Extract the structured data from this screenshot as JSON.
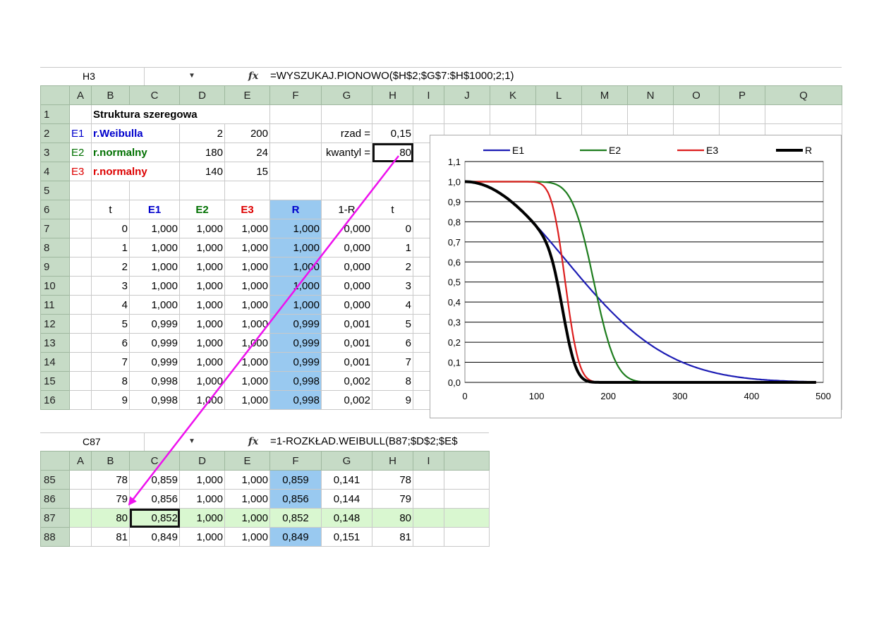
{
  "top": {
    "name_box": "H3",
    "formula": "=WYSZUKAJ.PIONOWO($H$2;$G$7:$H$1000;2;1)",
    "columns": [
      "A",
      "B",
      "C",
      "D",
      "E",
      "F",
      "G",
      "H",
      "I",
      "J",
      "K",
      "L",
      "M",
      "N",
      "O",
      "P",
      "Q"
    ],
    "row_headers": [
      "1",
      "2",
      "3",
      "4",
      "5",
      "6",
      "7",
      "8",
      "9",
      "10",
      "11",
      "12",
      "13",
      "14",
      "15",
      "16"
    ],
    "title": "Struktura szeregowa",
    "elements": [
      {
        "id": "E1",
        "dist": "r.Weibulla",
        "p1": "2",
        "p2": "200"
      },
      {
        "id": "E2",
        "dist": "r.normalny",
        "p1": "180",
        "p2": "24"
      },
      {
        "id": "E3",
        "dist": "r.normalny",
        "p1": "140",
        "p2": "15"
      }
    ],
    "rzad_label": "rzad =",
    "rzad_value": "0,15",
    "kwantyl_label": "kwantyl =",
    "kwantyl_value": "80",
    "headers": [
      "t",
      "E1",
      "E2",
      "E3",
      "R",
      "1-R",
      "t"
    ],
    "rows": [
      [
        "0",
        "1,000",
        "1,000",
        "1,000",
        "1,000",
        "0,000",
        "0"
      ],
      [
        "1",
        "1,000",
        "1,000",
        "1,000",
        "1,000",
        "0,000",
        "1"
      ],
      [
        "2",
        "1,000",
        "1,000",
        "1,000",
        "1,000",
        "0,000",
        "2"
      ],
      [
        "3",
        "1,000",
        "1,000",
        "1,000",
        "1,000",
        "0,000",
        "3"
      ],
      [
        "4",
        "1,000",
        "1,000",
        "1,000",
        "1,000",
        "0,000",
        "4"
      ],
      [
        "5",
        "0,999",
        "1,000",
        "1,000",
        "0,999",
        "0,001",
        "5"
      ],
      [
        "6",
        "0,999",
        "1,000",
        "1,000",
        "0,999",
        "0,001",
        "6"
      ],
      [
        "7",
        "0,999",
        "1,000",
        "1,000",
        "0,999",
        "0,001",
        "7"
      ],
      [
        "8",
        "0,998",
        "1,000",
        "1,000",
        "0,998",
        "0,002",
        "8"
      ],
      [
        "9",
        "0,998",
        "1,000",
        "1,000",
        "0,998",
        "0,002",
        "9"
      ]
    ]
  },
  "bottom": {
    "name_box": "C87",
    "formula": "=1-ROZKŁAD.WEIBULL(B87;$D$2;$E$",
    "columns": [
      "A",
      "B",
      "C",
      "D",
      "E",
      "F",
      "G",
      "H",
      "I",
      ""
    ],
    "rows": [
      {
        "rh": "85",
        "cells": [
          "78",
          "0,859",
          "1,000",
          "1,000",
          "0,859",
          "0,141",
          "78"
        ]
      },
      {
        "rh": "86",
        "cells": [
          "79",
          "0,856",
          "1,000",
          "1,000",
          "0,856",
          "0,144",
          "79"
        ]
      },
      {
        "rh": "87",
        "cells": [
          "80",
          "0,852",
          "1,000",
          "1,000",
          "0,852",
          "0,148",
          "80"
        ]
      },
      {
        "rh": "88",
        "cells": [
          "81",
          "0,849",
          "1,000",
          "1,000",
          "0,849",
          "0,151",
          "81"
        ]
      }
    ]
  },
  "chart_data": {
    "type": "line",
    "title": "",
    "xlim": [
      0,
      500
    ],
    "ylim": [
      0.0,
      1.1
    ],
    "xticks": [
      "0",
      "100",
      "200",
      "300",
      "400",
      "500"
    ],
    "yticks": [
      "0,0",
      "0,1",
      "0,2",
      "0,3",
      "0,4",
      "0,5",
      "0,6",
      "0,7",
      "0,8",
      "0,9",
      "1,0",
      "1,1"
    ],
    "grid": "horizontal",
    "legend": "top",
    "series": [
      {
        "name": "E1",
        "color": "#1c1cb4",
        "model": "weibull",
        "shape": 2,
        "scale": 200
      },
      {
        "name": "E2",
        "color": "#1e7d1e",
        "model": "normal",
        "mean": 180,
        "sd": 24
      },
      {
        "name": "E3",
        "color": "#dc1e1e",
        "model": "normal",
        "mean": 140,
        "sd": 15
      },
      {
        "name": "R",
        "color": "#000000",
        "model": "product"
      }
    ]
  },
  "annotation": {
    "arrow_color": "#ee11ee"
  }
}
